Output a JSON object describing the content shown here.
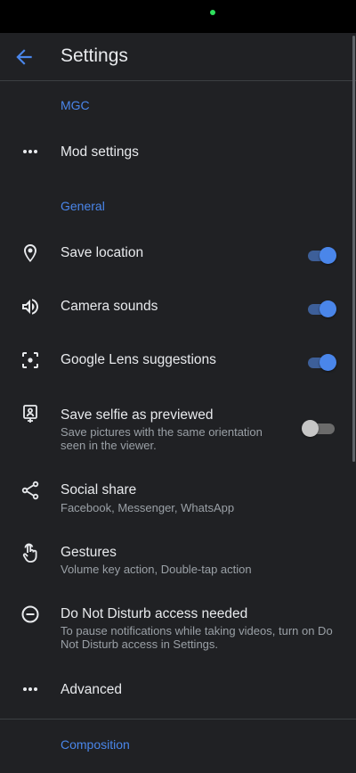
{
  "colors": {
    "accent": "#4a86ea",
    "accent_track": "#3d5f99",
    "text": "#e8eaed",
    "secondary": "#9aa0a6",
    "background": "#202124",
    "status_dot": "#2fe05d",
    "toggle_off_thumb": "#c6c6c6",
    "toggle_off_track": "#6b6b6b"
  },
  "header": {
    "title": "Settings",
    "back_icon": "arrow-left-icon"
  },
  "sections": {
    "mgc": "MGC",
    "general": "General",
    "composition": "Composition"
  },
  "rows": {
    "mod_settings": {
      "title": "Mod settings",
      "icon": "more-horiz-icon"
    },
    "save_location": {
      "title": "Save location",
      "icon": "location-pin-icon",
      "toggle": true
    },
    "camera_sounds": {
      "title": "Camera sounds",
      "icon": "volume-icon",
      "toggle": true
    },
    "google_lens": {
      "title": "Google Lens suggestions",
      "icon": "lens-icon",
      "toggle": true
    },
    "save_selfie": {
      "title": "Save selfie as previewed",
      "subtitle": "Save pictures with the same orientation seen in the viewer.",
      "icon": "selfie-portrait-icon",
      "toggle": false
    },
    "social_share": {
      "title": "Social share",
      "subtitle": "Facebook, Messenger, WhatsApp",
      "icon": "share-icon"
    },
    "gestures": {
      "title": "Gestures",
      "subtitle": "Volume key action, Double-tap action",
      "icon": "touch-gesture-icon"
    },
    "dnd": {
      "title": "Do Not Disturb access needed",
      "subtitle": "To pause notifications while taking videos, turn on Do Not Disturb access in Settings.",
      "icon": "do-not-disturb-icon"
    },
    "advanced": {
      "title": "Advanced",
      "icon": "more-horiz-icon"
    }
  }
}
